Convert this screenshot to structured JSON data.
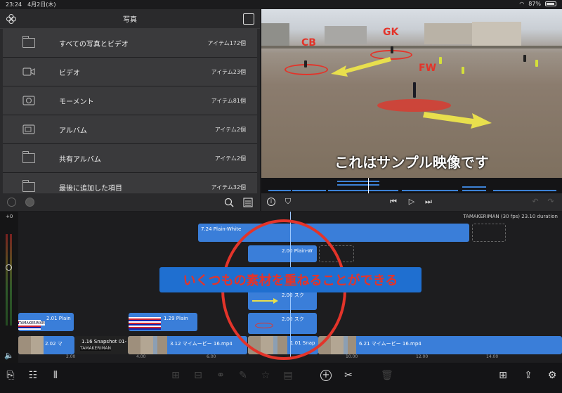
{
  "statusbar": {
    "time": "23:24",
    "date": "4月2日(木)",
    "battery": "87%"
  },
  "photos": {
    "title": "写真",
    "items": [
      {
        "label": "すべての写真とビデオ",
        "count": "アイテム172個",
        "icon": "folder-icon"
      },
      {
        "label": "ビデオ",
        "count": "アイテム23個",
        "icon": "video-icon"
      },
      {
        "label": "モーメント",
        "count": "アイテム81個",
        "icon": "moments-icon"
      },
      {
        "label": "アルバム",
        "count": "アイテム2個",
        "icon": "album-icon"
      },
      {
        "label": "共有アルバム",
        "count": "アイテム2個",
        "icon": "folder-icon"
      },
      {
        "label": "最後に追加した項目",
        "count": "アイテム32個",
        "icon": "folder-icon"
      }
    ]
  },
  "viewer": {
    "caption": "これはサンプル映像です",
    "tags": {
      "gk": "GK",
      "cb": "CB",
      "fw": "FW"
    }
  },
  "timeline": {
    "project_info": "TAMAKERIMAN  (30 fps)  23.10 duration",
    "meter_label": "+0",
    "annotation": "いくつもの素材を重ねることができる",
    "clips": {
      "c_white": "7.24   Plain-White",
      "c_plainw": "2.00   Plain-W",
      "c_sk1": "2.00   スク",
      "c_sk2": "2.00   スク",
      "c_plain1": "2.01   Plain",
      "c_1_29": "1.29   Plain",
      "c_v202": "2.02   マ",
      "c_snap": "1.16  Snapshot 01-",
      "c_snap_label": "TAMAKERIMAN",
      "c_312": "3.12   マイムービー 16.mp4",
      "c_101": "1.01   Snap",
      "c_621": "6.21   マイムービー 16.mp4",
      "title_strip": "TAMAKERIMAN"
    },
    "ruler": [
      "2.00",
      "4.00",
      "6.00",
      "10.00",
      "12.00",
      "14.00"
    ]
  },
  "colors": {
    "accent": "#3a7ed9",
    "annotation_red": "#e3342a"
  }
}
